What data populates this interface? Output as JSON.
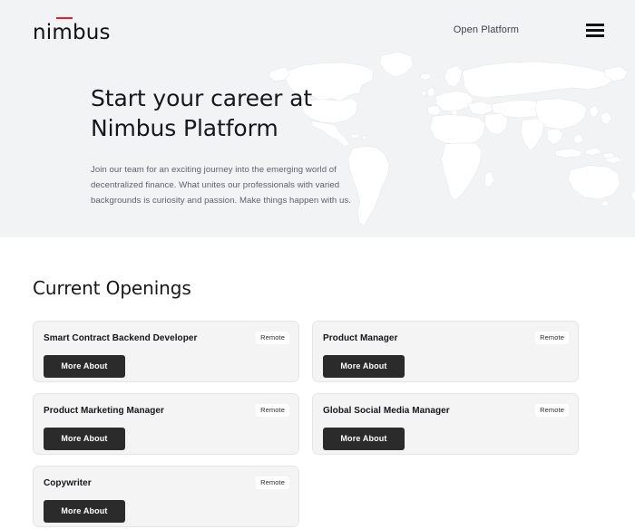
{
  "header": {
    "logo_text": "nimbus",
    "logo_accent_color": "#ed1b24",
    "nav_link_label": "Open Platform",
    "menu_icon": "hamburger-menu-icon"
  },
  "hero": {
    "title": "Start your career at Nimbus Platform",
    "subtitle": "Join our team for an exciting journey into the emerging world of decentralized finance. What unites our professionals with varied backgrounds is curiosity and passion. Make things happen with us.",
    "background_color": "#f2f3f5",
    "background_image": "world-map-outline"
  },
  "openings": {
    "section_title": "Current Openings",
    "button_label": "More About",
    "badge_label": "Remote",
    "card_background": "#f4f4f5",
    "button_color": "#2b2b2b",
    "jobs": [
      {
        "title": "Smart Contract Backend Developer",
        "location": "Remote",
        "cta": "More About"
      },
      {
        "title": "Product Manager",
        "location": "Remote",
        "cta": "More About"
      },
      {
        "title": "Product Marketing Manager",
        "location": "Remote",
        "cta": "More About"
      },
      {
        "title": "Global Social Media Manager",
        "location": "Remote",
        "cta": "More About"
      },
      {
        "title": "Copywriter",
        "location": "Remote",
        "cta": "More About"
      }
    ]
  }
}
